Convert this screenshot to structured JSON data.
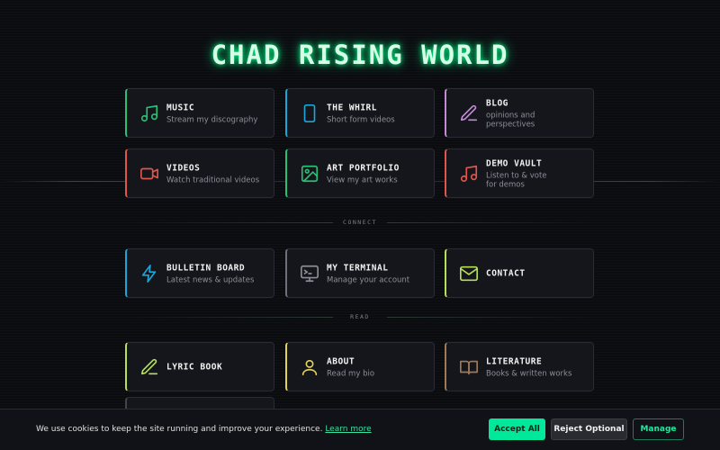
{
  "site": {
    "title": "CHAD RISING WORLD"
  },
  "sections": {
    "connect": "CONNECT",
    "read": "READ"
  },
  "cards": {
    "music": {
      "label": "MUSIC",
      "sub": "Stream my discography",
      "icon": "music-note-icon",
      "accent": "#2bbf73"
    },
    "whirl": {
      "label": "THE WHIRL",
      "sub": "Short form videos",
      "icon": "phone-icon",
      "accent": "#1aa7d8"
    },
    "blog": {
      "label": "BLOG",
      "sub": "opinions and perspectives",
      "icon": "pen-icon",
      "accent": "#c58ad6"
    },
    "videos": {
      "label": "VIDEOS",
      "sub": "Watch traditional videos",
      "icon": "video-camera-icon",
      "accent": "#e0564a"
    },
    "art": {
      "label": "ART PORTFOLIO",
      "sub": "View my art works",
      "icon": "image-icon",
      "accent": "#2bbf73"
    },
    "demo": {
      "label": "DEMO VAULT",
      "sub": "Listen to & vote for demos",
      "icon": "music-note-icon",
      "accent": "#e0564a"
    },
    "bulletin": {
      "label": "BULLETIN BOARD",
      "sub": "Latest news & updates",
      "icon": "lightning-icon",
      "accent": "#1aa7d8"
    },
    "terminal": {
      "label": "MY TERMINAL",
      "sub": "Manage your account",
      "icon": "monitor-icon",
      "accent": "#8a8d96"
    },
    "contact": {
      "label": "CONTACT",
      "sub": "",
      "icon": "mail-icon",
      "accent": "#b6e05a"
    },
    "lyric": {
      "label": "LYRIC BOOK",
      "sub": "",
      "icon": "pencil-icon",
      "accent": "#b6e05a"
    },
    "about": {
      "label": "ABOUT",
      "sub": "Read my bio",
      "icon": "user-icon",
      "accent": "#e3d25a"
    },
    "literature": {
      "label": "LITERATURE",
      "sub": "Books & written works",
      "icon": "book-icon",
      "accent": "#a07a56"
    }
  },
  "cookie": {
    "message": "We use cookies to keep the site running and improve your experience.",
    "learn_more": "Learn more",
    "accept": "Accept All",
    "reject": "Reject Optional",
    "manage": "Manage"
  }
}
